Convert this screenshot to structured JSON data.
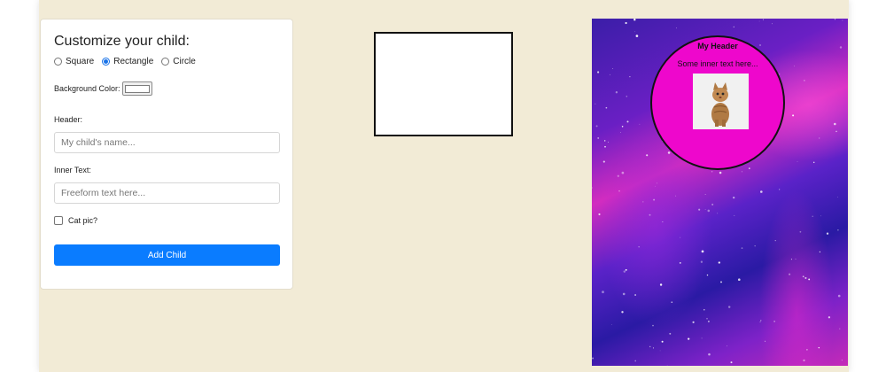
{
  "form": {
    "title": "Customize your child:",
    "shape_options": [
      {
        "label": "Square",
        "checked": false
      },
      {
        "label": "Rectangle",
        "checked": true
      },
      {
        "label": "Circle",
        "checked": false
      }
    ],
    "background_color_label": "Background Color:",
    "background_color_value": "#ffffff",
    "header_label": "Header:",
    "header_placeholder": "My child's name...",
    "inner_text_label": "Inner Text:",
    "inner_text_placeholder": "Freeform text here...",
    "cat_pic_label": "Cat pic?",
    "cat_pic_checked": false,
    "add_button_label": "Add Child"
  },
  "child": {
    "header": "My Header",
    "inner_text": "Some inner text here...",
    "fill_color": "#ee07cc"
  },
  "colors": {
    "page_background": "#f2ebd6",
    "accent": "#0a7cff"
  }
}
